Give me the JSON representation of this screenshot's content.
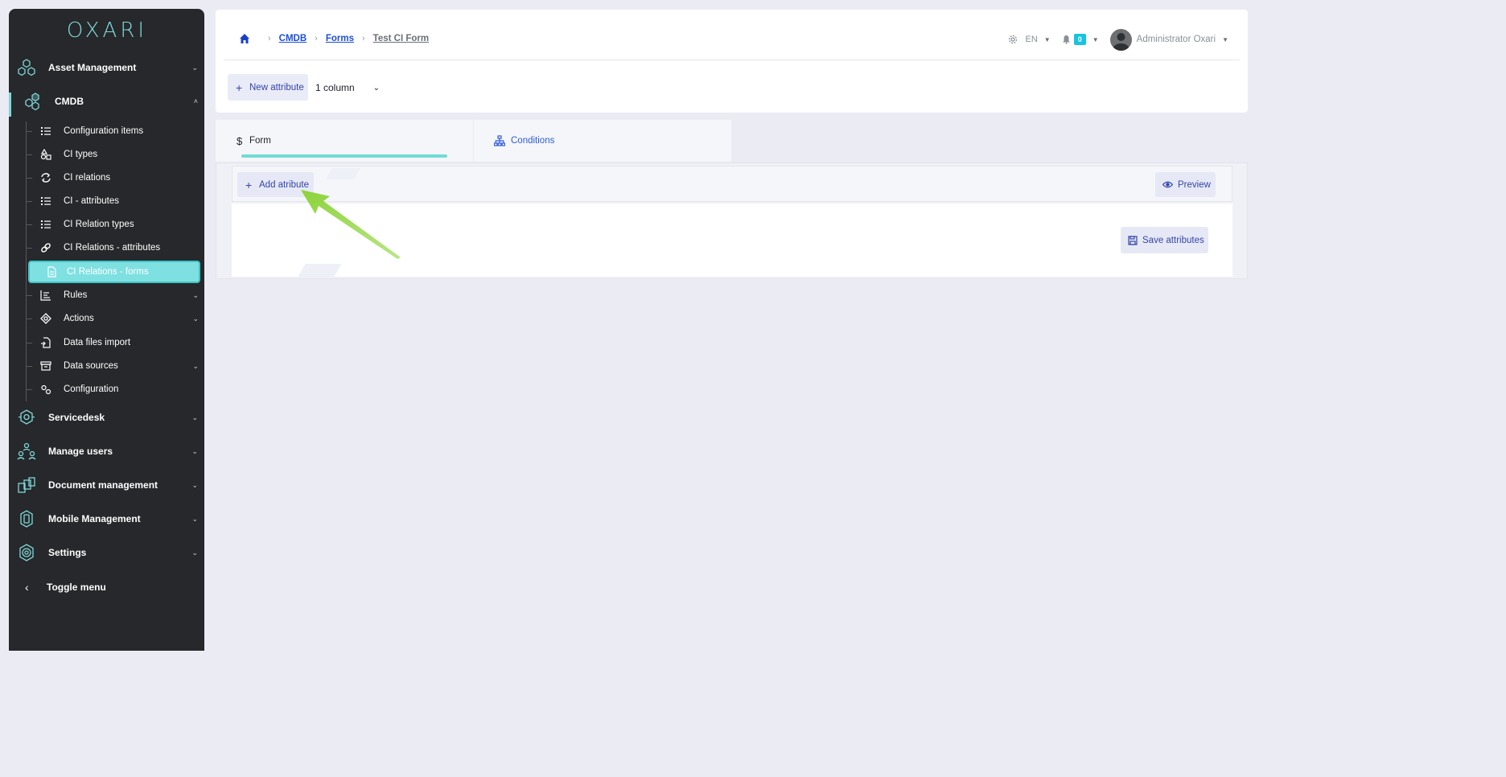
{
  "app": {
    "logo_text": "OXARI",
    "accent": "#7fd8d9"
  },
  "sidebar": {
    "sections": [
      {
        "label": "Asset Management",
        "icon": "asset-management-icon"
      },
      {
        "label": "CMDB",
        "icon": "cmdb-icon"
      },
      {
        "label": "Servicedesk",
        "icon": "servicedesk-icon"
      },
      {
        "label": "Manage users",
        "icon": "manage-users-icon"
      },
      {
        "label": "Document management",
        "icon": "document-management-icon"
      },
      {
        "label": "Mobile Management",
        "icon": "mobile-management-icon"
      },
      {
        "label": "Settings",
        "icon": "settings-icon"
      }
    ],
    "cmdb_items": [
      {
        "label": "Configuration items",
        "icon": "list-icon"
      },
      {
        "label": "CI types",
        "icon": "shapes-icon"
      },
      {
        "label": "CI relations",
        "icon": "sync-icon"
      },
      {
        "label": "CI - attributes",
        "icon": "list-icon"
      },
      {
        "label": "CI Relation types",
        "icon": "list-icon"
      },
      {
        "label": "CI Relations - attributes",
        "icon": "link-icon"
      },
      {
        "label": "CI Relations - forms",
        "icon": "file-icon"
      },
      {
        "label": "Rules",
        "icon": "chart-icon"
      },
      {
        "label": "Actions",
        "icon": "target-icon"
      },
      {
        "label": "Data files import",
        "icon": "file-import-icon"
      },
      {
        "label": "Data sources",
        "icon": "box-icon"
      },
      {
        "label": "Configuration",
        "icon": "cogs-icon"
      }
    ],
    "toggle_label": "Toggle menu"
  },
  "header": {
    "breadcrumb": [
      "CMDB",
      "Forms",
      "Test CI Form"
    ],
    "language": "EN",
    "notification_count": "0",
    "user_name": "Administrator Oxari"
  },
  "toolbar": {
    "new_attribute_label": "New attribute",
    "columns_value": "1 column"
  },
  "tabs": [
    {
      "label": "Form",
      "icon": "dollar-icon"
    },
    {
      "label": "Conditions",
      "icon": "sitemap-icon"
    }
  ],
  "form": {
    "add_attribute_label": "Add atribute",
    "preview_label": "Preview",
    "save_label": "Save attributes"
  },
  "annotation": {
    "arrow_color": "#8cd43a"
  }
}
